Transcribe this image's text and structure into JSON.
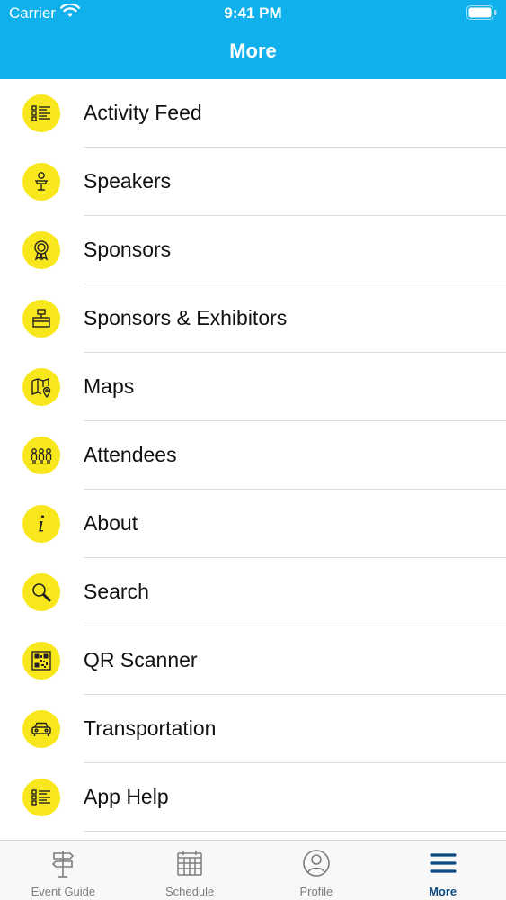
{
  "status_bar": {
    "carrier": "Carrier",
    "time": "9:41 PM"
  },
  "header": {
    "title": "More"
  },
  "menu": {
    "items": [
      {
        "label": "Activity Feed",
        "icon": "list-icon"
      },
      {
        "label": "Speakers",
        "icon": "speaker-podium-icon"
      },
      {
        "label": "Sponsors",
        "icon": "award-ribbon-icon"
      },
      {
        "label": "Sponsors & Exhibitors",
        "icon": "exhibitor-booth-icon"
      },
      {
        "label": "Maps",
        "icon": "map-pin-icon"
      },
      {
        "label": "Attendees",
        "icon": "people-group-icon"
      },
      {
        "label": "About",
        "icon": "info-icon"
      },
      {
        "label": "Search",
        "icon": "search-icon"
      },
      {
        "label": "QR Scanner",
        "icon": "qr-code-icon"
      },
      {
        "label": "Transportation",
        "icon": "car-icon"
      },
      {
        "label": "App Help",
        "icon": "list-icon"
      }
    ]
  },
  "tabbar": {
    "tabs": [
      {
        "label": "Event Guide",
        "icon": "signpost-icon",
        "active": false
      },
      {
        "label": "Schedule",
        "icon": "calendar-icon",
        "active": false
      },
      {
        "label": "Profile",
        "icon": "user-circle-icon",
        "active": false
      },
      {
        "label": "More",
        "icon": "hamburger-menu-icon",
        "active": true
      }
    ]
  },
  "colors": {
    "header_bg": "#0fb0ec",
    "icon_bg": "#f8e71c",
    "active_tab": "#0b4a82",
    "inactive_tab": "#7d7d7d"
  }
}
